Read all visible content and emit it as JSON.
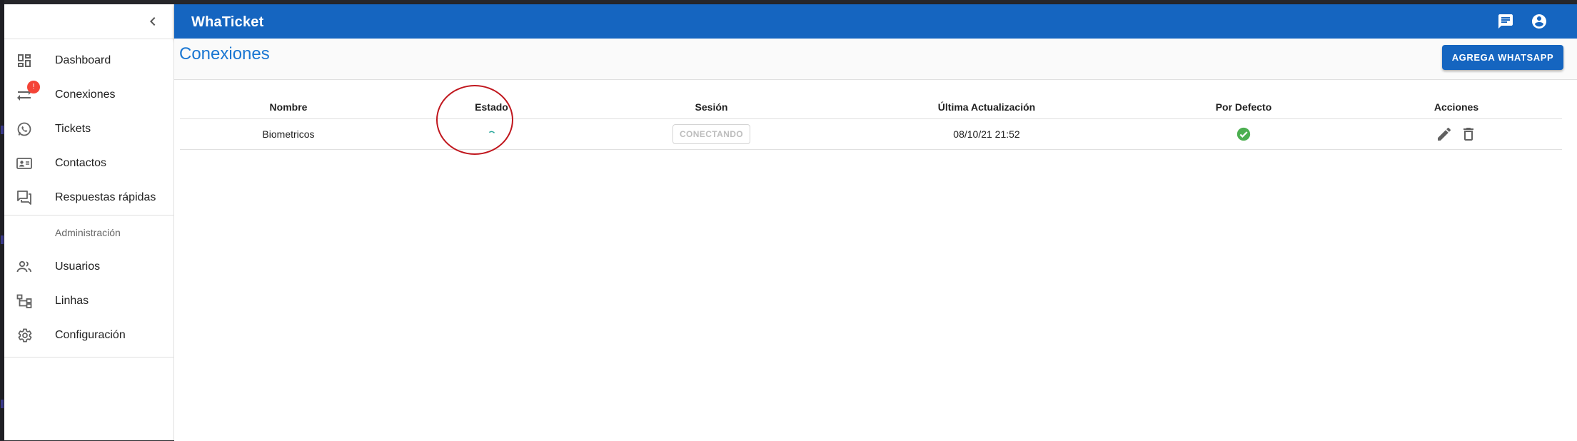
{
  "app": {
    "title": "WhaTicket"
  },
  "sidebar": {
    "items": [
      {
        "label": "Dashboard",
        "icon": "dashboard-icon"
      },
      {
        "label": "Conexiones",
        "icon": "sync-alt-icon",
        "badge": "!"
      },
      {
        "label": "Tickets",
        "icon": "whatsapp-icon"
      },
      {
        "label": "Contactos",
        "icon": "contact-card-icon"
      },
      {
        "label": "Respuestas rápidas",
        "icon": "quick-replies-icon"
      }
    ],
    "admin_header": "Administración",
    "admin_items": [
      {
        "label": "Usuarios",
        "icon": "people-icon"
      },
      {
        "label": "Linhas",
        "icon": "account-tree-icon"
      },
      {
        "label": "Configuración",
        "icon": "settings-icon"
      }
    ]
  },
  "page": {
    "title": "Conexiones",
    "add_button": "AGREGA WHATSAPP"
  },
  "table": {
    "headers": [
      "Nombre",
      "Estado",
      "Sesión",
      "Última Actualización",
      "Por Defecto",
      "Acciones"
    ],
    "rows": [
      {
        "name": "Biometricos",
        "status": "loading",
        "session": "CONECTANDO",
        "updated": "08/10/21 21:52",
        "default": true
      }
    ]
  },
  "colors": {
    "primary": "#1565c0",
    "title_blue": "#1976d2",
    "badge": "#f44336",
    "success": "#4caf50",
    "spinner": "#26a69a",
    "annotation": "#c0161d"
  }
}
